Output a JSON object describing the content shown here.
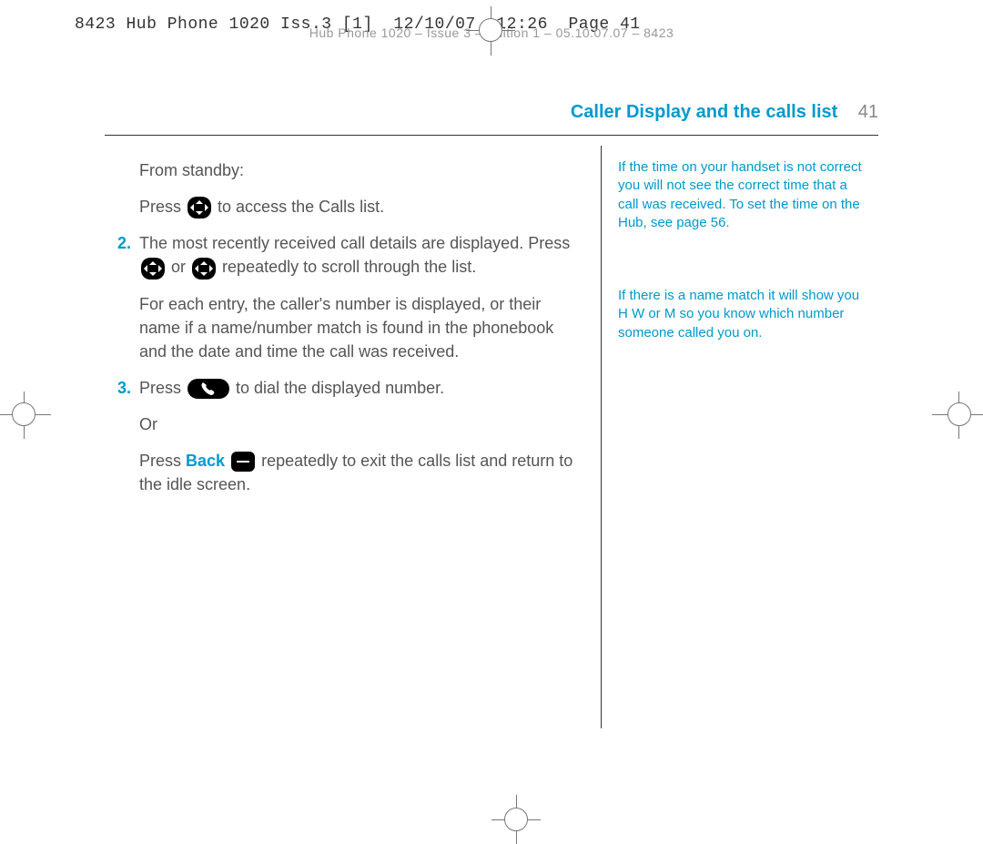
{
  "crop_header": "8423 Hub Phone 1020 Iss.3 [1]  12/10/07  12:26  Page 41",
  "faded_header": "Hub Phone 1020 – Issue 3 – Edition 1 – 05.10.07.07 – 8423",
  "title": "Caller Display and the calls list",
  "page_number": "41",
  "left": {
    "p1_intro": "From standby:",
    "p1_a": "Press ",
    "p1_b": " to access the Calls list.",
    "step2_num": "2.",
    "p2_a": "The most recently received call details are displayed. Press ",
    "p2_b": " or ",
    "p2_c": " repeatedly to scroll through the list.",
    "p3": "For each entry, the caller's number is displayed, or their name if a name/number match is found in the phonebook and the date and time the call was received.",
    "step3_num": "3.",
    "p4_a": "Press ",
    "p4_b": " to dial the displayed number.",
    "p5": "Or",
    "p6_a": "Press ",
    "p6_back": "Back",
    "p6_b": " repeatedly to exit the calls list and return to the idle screen."
  },
  "right": {
    "note1": "If the time on your handset is not correct you will not see the correct time that a call was received. To set the time on the Hub, see page 56.",
    "note2": "If there is a name match it will show you H W or M so you know which number someone called you on."
  }
}
